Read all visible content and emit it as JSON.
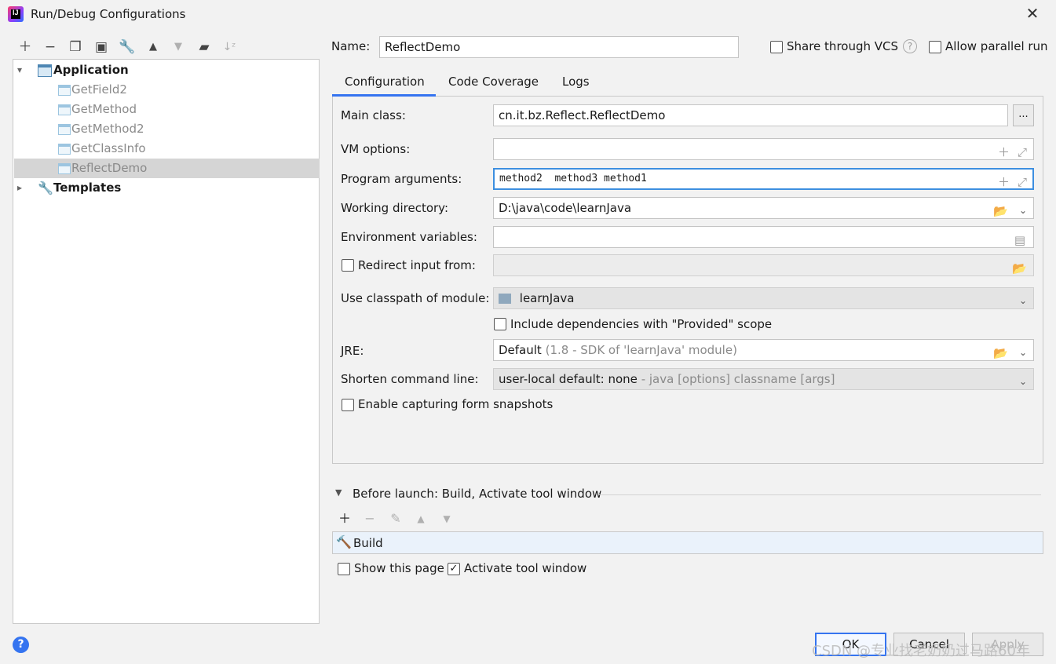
{
  "window": {
    "title": "Run/Debug Configurations",
    "app_icon_letter": "IJ"
  },
  "toolbar": {
    "icons": [
      "add-icon",
      "remove-icon",
      "copy-icon",
      "save-icon",
      "wrench-icon",
      "move-up-icon",
      "move-down-icon",
      "new-folder-icon",
      "sort-az-icon"
    ]
  },
  "tree": {
    "application_label": "Application",
    "items": [
      {
        "label": "GetField2"
      },
      {
        "label": "GetMethod"
      },
      {
        "label": "GetMethod2"
      },
      {
        "label": "GetClassInfo"
      },
      {
        "label": "ReflectDemo"
      }
    ],
    "templates_label": "Templates"
  },
  "header": {
    "name_label": "Name:",
    "name_value": "ReflectDemo",
    "share_vcs_label": "Share through VCS",
    "allow_parallel_label": "Allow parallel run"
  },
  "tabs": [
    {
      "label": "Configuration"
    },
    {
      "label": "Code Coverage"
    },
    {
      "label": "Logs"
    }
  ],
  "config": {
    "main_class_label": "Main class:",
    "main_class_value": "cn.it.bz.Reflect.ReflectDemo",
    "browse_label": "...",
    "vm_options_label": "VM options:",
    "vm_options_value": "",
    "program_args_label": "Program arguments:",
    "program_args_value": "method2  method3 method1",
    "working_dir_label": "Working directory:",
    "working_dir_value": "D:\\java\\code\\learnJava",
    "env_vars_label": "Environment variables:",
    "env_vars_value": "",
    "redirect_label": "Redirect input from:",
    "classpath_label": "Use classpath of module:",
    "classpath_value": "learnJava",
    "include_deps_label": "Include dependencies with \"Provided\" scope",
    "jre_label": "JRE:",
    "jre_value": "Default",
    "jre_hint": "(1.8 - SDK of 'learnJava' module)",
    "shorten_label": "Shorten command line:",
    "shorten_value": "user-local default: none",
    "shorten_hint": "- java [options] classname [args]",
    "snapshots_label": "Enable capturing form snapshots"
  },
  "before_launch": {
    "title": "Before launch: Build, Activate tool window",
    "build_label": "Build",
    "show_page_label": "Show this page",
    "activate_label": "Activate tool window",
    "activate_checked": true,
    "show_page_checked": false
  },
  "buttons": {
    "ok": "OK",
    "cancel": "Cancel",
    "apply": "Apply"
  },
  "watermark": "CSDN @专业找老奶奶过马路60年",
  "colors": {
    "accent": "#3574f0",
    "selection": "#d5d5d5",
    "focus_border": "#3d8fe0"
  }
}
